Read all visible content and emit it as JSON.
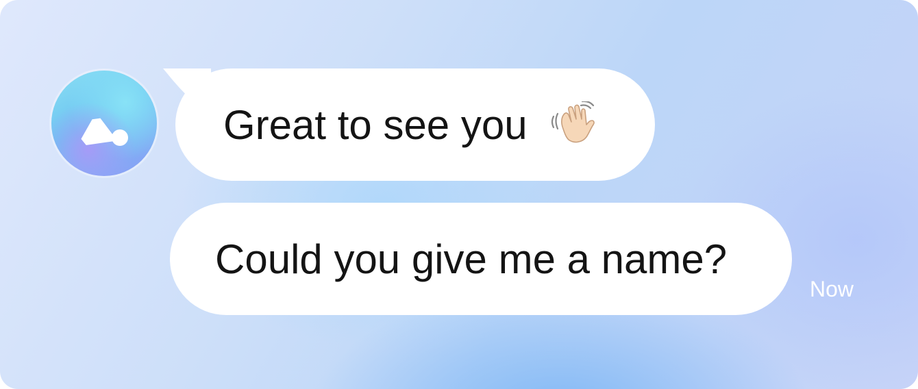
{
  "chat": {
    "avatar": {
      "icon": "assistant-logo-icon",
      "colors": {
        "cyan": "#8be0f3",
        "blue": "#6cc3f2",
        "violet": "#8e9bf6"
      }
    },
    "messages": [
      {
        "text": "Great to see you",
        "emoji": "waving-hand-icon"
      },
      {
        "text": "Could you give me a name?"
      }
    ],
    "timestamp": "Now"
  },
  "colors": {
    "bubble": "#ffffff",
    "text": "#141414",
    "timestamp": "#ffffff"
  }
}
